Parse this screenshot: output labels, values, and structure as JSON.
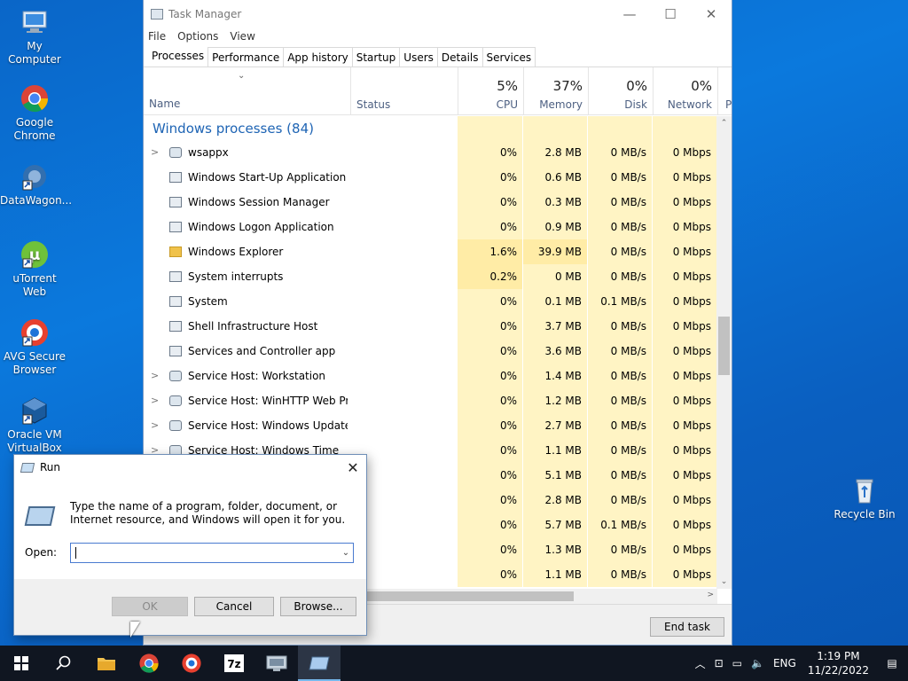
{
  "desktop": {
    "icons": [
      {
        "label": "My Computer",
        "icon": "computer-icon"
      },
      {
        "label": "Google Chrome",
        "icon": "chrome-icon"
      },
      {
        "label": "DataWagon...",
        "icon": "datawagon-icon"
      },
      {
        "label": "uTorrent Web",
        "icon": "utorrent-icon"
      },
      {
        "label": "AVG Secure Browser",
        "icon": "avg-browser-icon"
      },
      {
        "label": "Oracle VM VirtualBox",
        "icon": "virtualbox-icon"
      },
      {
        "label": "Recycle Bin",
        "icon": "recycle-bin-icon"
      }
    ]
  },
  "task_manager": {
    "title": "Task Manager",
    "menu": [
      "File",
      "Options",
      "View"
    ],
    "tabs": [
      "Processes",
      "Performance",
      "App history",
      "Startup",
      "Users",
      "Details",
      "Services"
    ],
    "active_tab": "Processes",
    "columns": {
      "name": "Name",
      "status": "Status",
      "cpu": {
        "pct": "5%",
        "label": "CPU"
      },
      "memory": {
        "pct": "37%",
        "label": "Memory"
      },
      "disk": {
        "pct": "0%",
        "label": "Disk"
      },
      "network": {
        "pct": "0%",
        "label": "Network"
      },
      "power_partial": "P"
    },
    "group": "Windows processes (84)",
    "rows": [
      {
        "name": "wsappx",
        "cpu": "0%",
        "mem": "2.8 MB",
        "disk": "0 MB/s",
        "net": "0 Mbps",
        "expand": true,
        "icon": "gear"
      },
      {
        "name": "Windows Start-Up Application",
        "cpu": "0%",
        "mem": "0.6 MB",
        "disk": "0 MB/s",
        "net": "0 Mbps",
        "expand": false,
        "icon": "window"
      },
      {
        "name": "Windows Session Manager",
        "cpu": "0%",
        "mem": "0.3 MB",
        "disk": "0 MB/s",
        "net": "0 Mbps",
        "expand": false,
        "icon": "window"
      },
      {
        "name": "Windows Logon Application",
        "cpu": "0%",
        "mem": "0.9 MB",
        "disk": "0 MB/s",
        "net": "0 Mbps",
        "expand": false,
        "icon": "window"
      },
      {
        "name": "Windows Explorer",
        "cpu": "1.6%",
        "mem": "39.9 MB",
        "disk": "0 MB/s",
        "net": "0 Mbps",
        "expand": false,
        "icon": "folder"
      },
      {
        "name": "System interrupts",
        "cpu": "0.2%",
        "mem": "0 MB",
        "disk": "0 MB/s",
        "net": "0 Mbps",
        "expand": false,
        "icon": "window"
      },
      {
        "name": "System",
        "cpu": "0%",
        "mem": "0.1 MB",
        "disk": "0.1 MB/s",
        "net": "0 Mbps",
        "expand": false,
        "icon": "window"
      },
      {
        "name": "Shell Infrastructure Host",
        "cpu": "0%",
        "mem": "3.7 MB",
        "disk": "0 MB/s",
        "net": "0 Mbps",
        "expand": false,
        "icon": "window"
      },
      {
        "name": "Services and Controller app",
        "cpu": "0%",
        "mem": "3.6 MB",
        "disk": "0 MB/s",
        "net": "0 Mbps",
        "expand": false,
        "icon": "window"
      },
      {
        "name": "Service Host: Workstation",
        "cpu": "0%",
        "mem": "1.4 MB",
        "disk": "0 MB/s",
        "net": "0 Mbps",
        "expand": true,
        "icon": "gear"
      },
      {
        "name": "Service Host: WinHTTP Web Pro...",
        "cpu": "0%",
        "mem": "1.2 MB",
        "disk": "0 MB/s",
        "net": "0 Mbps",
        "expand": true,
        "icon": "gear"
      },
      {
        "name": "Service Host: Windows Update",
        "cpu": "0%",
        "mem": "2.7 MB",
        "disk": "0 MB/s",
        "net": "0 Mbps",
        "expand": true,
        "icon": "gear"
      },
      {
        "name": "Service Host: Windows Time",
        "cpu": "0%",
        "mem": "1.1 MB",
        "disk": "0 MB/s",
        "net": "0 Mbps",
        "expand": true,
        "icon": "gear"
      },
      {
        "name": "",
        "cpu": "0%",
        "mem": "5.1 MB",
        "disk": "0 MB/s",
        "net": "0 Mbps",
        "expand": false,
        "icon": ""
      },
      {
        "name": "",
        "cpu": "0%",
        "mem": "2.8 MB",
        "disk": "0 MB/s",
        "net": "0 Mbps",
        "expand": false,
        "icon": ""
      },
      {
        "name": "",
        "cpu": "0%",
        "mem": "5.7 MB",
        "disk": "0.1 MB/s",
        "net": "0 Mbps",
        "expand": false,
        "icon": ""
      },
      {
        "name": "",
        "cpu": "0%",
        "mem": "1.3 MB",
        "disk": "0 MB/s",
        "net": "0 Mbps",
        "expand": false,
        "icon": ""
      },
      {
        "name": "",
        "cpu": "0%",
        "mem": "1.1 MB",
        "disk": "0 MB/s",
        "net": "0 Mbps",
        "expand": false,
        "icon": ""
      }
    ],
    "end_task": "End task"
  },
  "run_dialog": {
    "title": "Run",
    "description": "Type the name of a program, folder, document, or Internet resource, and Windows will open it for you.",
    "open_label": "Open:",
    "open_value": "",
    "ok": "OK",
    "cancel": "Cancel",
    "browse": "Browse..."
  },
  "taskbar": {
    "apps": [
      "start-icon",
      "search-icon",
      "file-explorer-icon",
      "chrome-icon",
      "avg-browser-icon",
      "7zip-icon",
      "remote-desktop-icon",
      "run-icon"
    ],
    "active_app": "run-icon",
    "language": "ENG",
    "time": "1:19 PM",
    "date": "11/22/2022"
  },
  "colors": {
    "desktop": "#0a66c8",
    "taskbar": "#101621",
    "group_heading": "#1e64b4",
    "cell_light": "#fff4c4",
    "cell_mid": "#ffeca6"
  }
}
